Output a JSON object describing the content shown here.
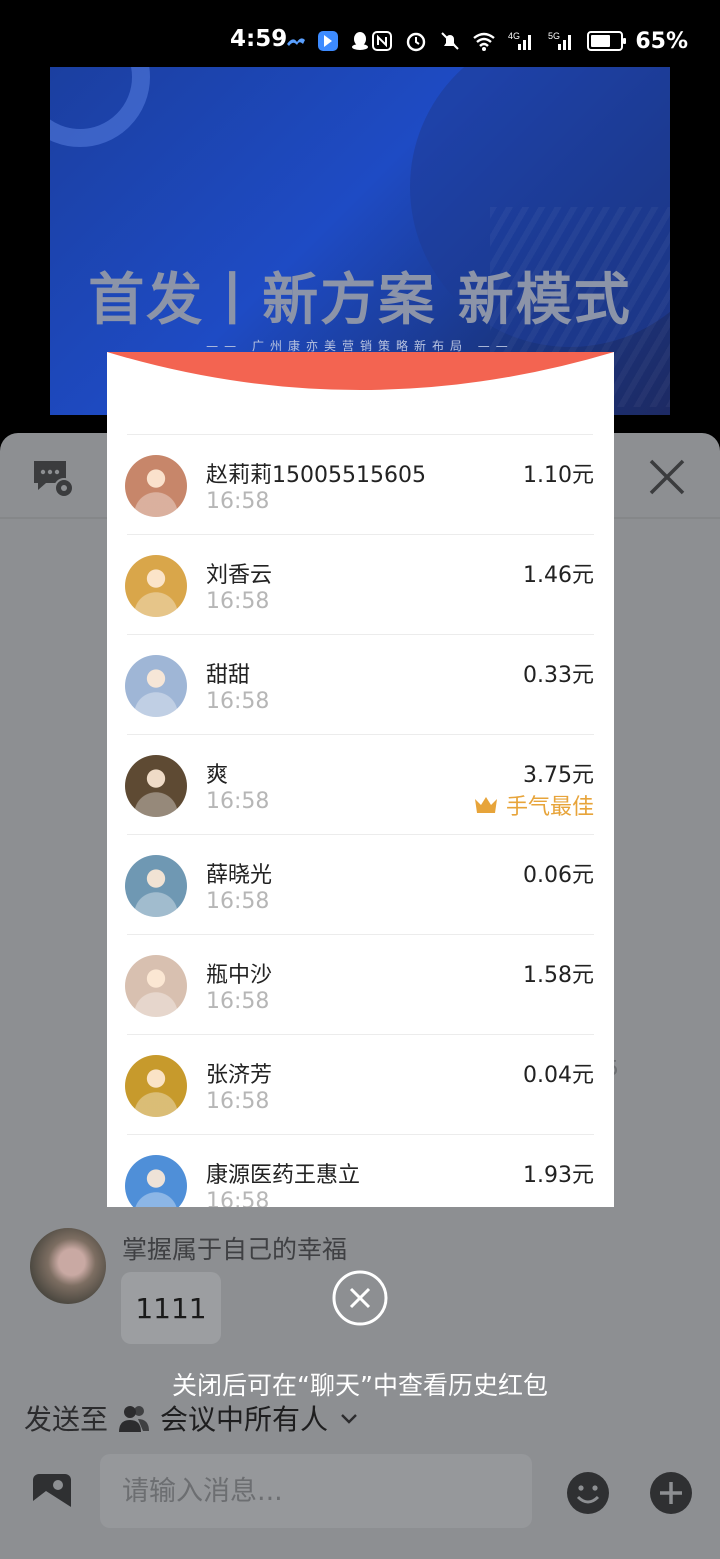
{
  "status_bar": {
    "time": "4:59",
    "battery_percent": 65,
    "battery_text": "65%",
    "network_4g": "4G",
    "network_5g": "5G"
  },
  "banner": {
    "title": "首发丨新方案 新模式",
    "subtitle": "—— 广州康亦美营销策略新布局 ——"
  },
  "red_packet": {
    "receivers": [
      {
        "name": "赵莉莉15005515605",
        "time": "16:58",
        "amount": "1.10元",
        "avatar_color": "#c7866a"
      },
      {
        "name": "刘香云",
        "time": "16:58",
        "amount": "1.46元",
        "avatar_color": "#d9a64a"
      },
      {
        "name": "甜甜",
        "time": "16:58",
        "amount": "0.33元",
        "avatar_color": "#9fb6d6"
      },
      {
        "name": "爽",
        "time": "16:58",
        "amount": "3.75元",
        "avatar_color": "#5e4a33",
        "best_luck": "手气最佳"
      },
      {
        "name": "薛晓光",
        "time": "16:58",
        "amount": "0.06元",
        "avatar_color": "#6f98b3"
      },
      {
        "name": "瓶中沙",
        "time": "16:58",
        "amount": "1.58元",
        "avatar_color": "#d8c0b0"
      },
      {
        "name": "张济芳",
        "time": "16:58",
        "amount": "0.04元",
        "avatar_color": "#c79a2c"
      },
      {
        "name": "康源医药王惠立",
        "time": "16:58",
        "amount": "1.93元",
        "avatar_color": "#4f8fd8"
      }
    ],
    "close_hint": "关闭后可在“聊天”中查看历史红包"
  },
  "chat": {
    "sender_name": "掌握属于自己的幸福",
    "message": "1111",
    "partial_text": "5",
    "send_to_label": "发送至",
    "send_to_target": "会议中所有人",
    "input_placeholder": "请输入消息..."
  },
  "colors": {
    "popup_arc": "#f36451",
    "best_luck": "#e7a43a",
    "overlay_panel": "#8d8f92"
  }
}
